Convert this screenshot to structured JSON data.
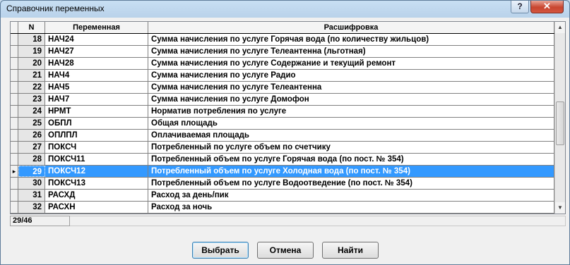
{
  "window": {
    "title": "Справочник переменных",
    "help_label": "?",
    "close_label": "✕"
  },
  "table": {
    "columns": [
      "N",
      "Переменная",
      "Расшифровка"
    ],
    "rows": [
      {
        "n": "18",
        "var": "НАЧ24",
        "desc": "Сумма начисления по услуге Горячая вода  (по количеству жильцов)"
      },
      {
        "n": "19",
        "var": "НАЧ27",
        "desc": "Сумма начисления по услуге Телеантенна (льготная)"
      },
      {
        "n": "20",
        "var": "НАЧ28",
        "desc": "Сумма начисления по услуге Содержание и текущий ремонт"
      },
      {
        "n": "21",
        "var": "НАЧ4",
        "desc": "Сумма начисления по услуге Радио"
      },
      {
        "n": "22",
        "var": "НАЧ5",
        "desc": "Сумма начисления по услуге Телеантенна"
      },
      {
        "n": "23",
        "var": "НАЧ7",
        "desc": "Сумма начисления по услуге Домофон"
      },
      {
        "n": "24",
        "var": "НРМТ",
        "desc": "Норматив потребления по услуге"
      },
      {
        "n": "25",
        "var": "ОБПЛ",
        "desc": "Общая площадь"
      },
      {
        "n": "26",
        "var": "ОПЛПЛ",
        "desc": "Оплачиваемая площадь"
      },
      {
        "n": "27",
        "var": "ПОКСЧ",
        "desc": "Потребленный по услуге объем по счетчику"
      },
      {
        "n": "28",
        "var": "ПОКСЧ11",
        "desc": "Потребленный объем по услуге Горячая вода (по пост. № 354)"
      },
      {
        "n": "29",
        "var": "ПОКСЧ12",
        "desc": "Потребленный объем по услуге Холодная вода (по пост. № 354)"
      },
      {
        "n": "30",
        "var": "ПОКСЧ13",
        "desc": "Потребленный объем по услуге Водоотведение (по пост. № 354)"
      },
      {
        "n": "31",
        "var": "РАСХД",
        "desc": "Расход за день/пик"
      },
      {
        "n": "32",
        "var": "РАСХН",
        "desc": "Расход за ночь"
      }
    ],
    "selected_n": "29",
    "row_indicator": "▸"
  },
  "status": {
    "position": "29/46"
  },
  "buttons": {
    "select": "Выбрать",
    "cancel": "Отмена",
    "find": "Найти"
  },
  "colors": {
    "selection": "#3399ff"
  }
}
